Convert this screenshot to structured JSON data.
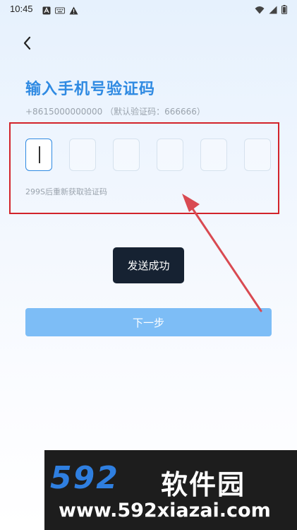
{
  "status_bar": {
    "time": "10:45",
    "left_icons": [
      "a-square-icon",
      "keyboard-icon",
      "warning-icon"
    ],
    "right_icons": [
      "wifi-icon",
      "signal-icon",
      "battery-icon"
    ]
  },
  "header": {
    "back_icon": "chevron-left-icon"
  },
  "main": {
    "title": "输入手机号验证码",
    "phone_hint": "+8615000000000 （默认验证码：666666）",
    "code_boxes": [
      "",
      "",
      "",
      "",
      "",
      ""
    ],
    "active_box_index": 0,
    "resend_hint": "299S后重新获取验证码",
    "toast": "发送成功",
    "next_button": "下一步"
  },
  "annotation": {
    "highlight_color": "#d2232a",
    "arrow_color": "#d94a52"
  },
  "colors": {
    "accent": "#2f8ae2",
    "button_bg": "#7dbdf6",
    "toast_bg": "#162232"
  },
  "watermark": {
    "logo_text": "592",
    "site_name": "软件园",
    "url": "www.592xiazai.com"
  }
}
